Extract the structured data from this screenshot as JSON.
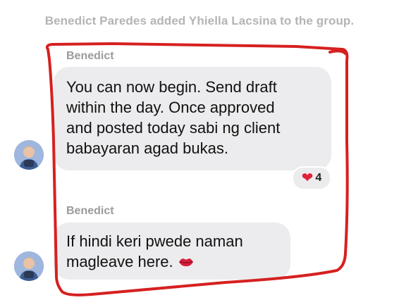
{
  "system_message": "Benedict Paredes added Yhiella Lacsina to the group.",
  "messages": [
    {
      "sender": "Benedict",
      "lines": [
        "You can now begin. Send draft",
        "within the day. Once approved",
        "and posted today sabi ng client",
        "babayaran agad bukas."
      ],
      "reaction": {
        "icon": "heart-icon",
        "count": "4"
      }
    },
    {
      "sender": "Benedict",
      "lines": [
        "If hindi keri pwede naman",
        "magleave here."
      ],
      "trailing_icon": "kiss-lips-icon"
    }
  ],
  "colors": {
    "bubble": "#ececee",
    "system_text": "#b4b4b6",
    "sender_text": "#9b9b9e",
    "annotation_stroke": "#d62020",
    "heart": "#e0233b"
  }
}
